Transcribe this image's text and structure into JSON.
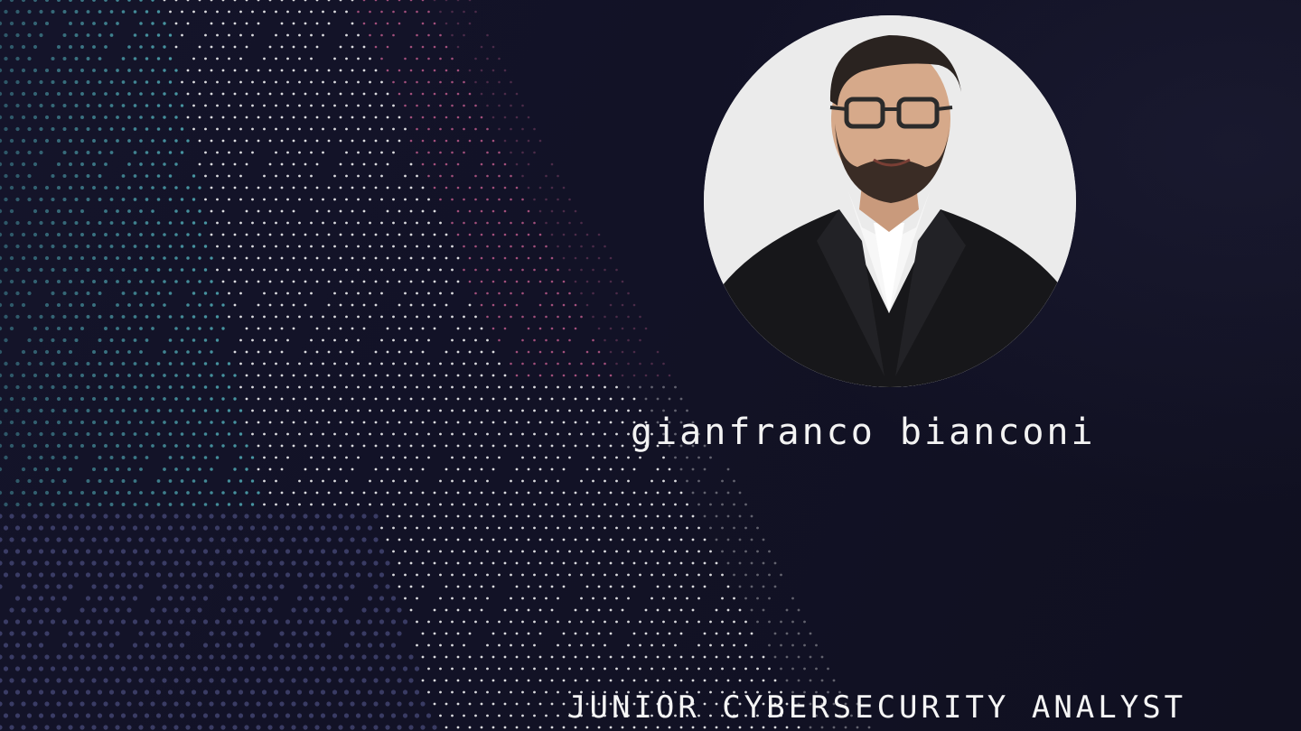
{
  "profile": {
    "name": "gianfranco bianconi",
    "title": "Junior cybersecurity analyst"
  },
  "colors": {
    "background": "#11111f",
    "dots_teal": "#5fd0d8",
    "dots_pink": "#e06aa0",
    "dots_white": "#ffffff",
    "text": "#f3f3f3"
  },
  "icons": {
    "portrait": "profile-photo"
  }
}
